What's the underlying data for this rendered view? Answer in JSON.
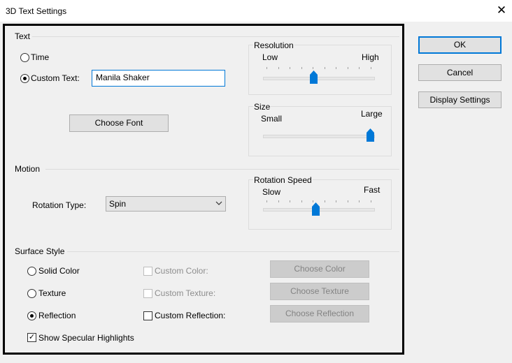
{
  "window": {
    "title": "3D Text Settings",
    "close_glyph": "✕"
  },
  "text_section": {
    "label": "Text",
    "time_label": "Time",
    "custom_text_label": "Custom Text:",
    "custom_text_value": "Manila Shaker",
    "choose_font_label": "Choose Font",
    "selected": "custom_text"
  },
  "resolution": {
    "label": "Resolution",
    "min_label": "Low",
    "max_label": "High",
    "value_fraction": 0.45
  },
  "size": {
    "label": "Size",
    "min_label": "Small",
    "max_label": "Large",
    "value_fraction": 1.0
  },
  "motion": {
    "label": "Motion",
    "rotation_type_label": "Rotation Type:",
    "rotation_type_value": "Spin"
  },
  "rotation_speed": {
    "label": "Rotation Speed",
    "min_label": "Slow",
    "max_label": "Fast",
    "value_fraction": 0.47
  },
  "surface_style": {
    "label": "Surface Style",
    "solid_color_label": "Solid Color",
    "texture_label": "Texture",
    "reflection_label": "Reflection",
    "custom_color_label": "Custom Color:",
    "custom_texture_label": "Custom Texture:",
    "custom_reflection_label": "Custom Reflection:",
    "choose_color_label": "Choose Color",
    "choose_texture_label": "Choose Texture",
    "choose_reflection_label": "Choose Reflection",
    "specular_label": "Show Specular Highlights",
    "selected": "reflection",
    "specular_checked": true,
    "check_glyph": "✓"
  },
  "buttons": {
    "ok_label": "OK",
    "cancel_label": "Cancel",
    "display_settings_label": "Display Settings"
  },
  "colors": {
    "accent": "#0078d7",
    "background": "#f0f0f0",
    "disabled_text": "#8d8d8d"
  }
}
